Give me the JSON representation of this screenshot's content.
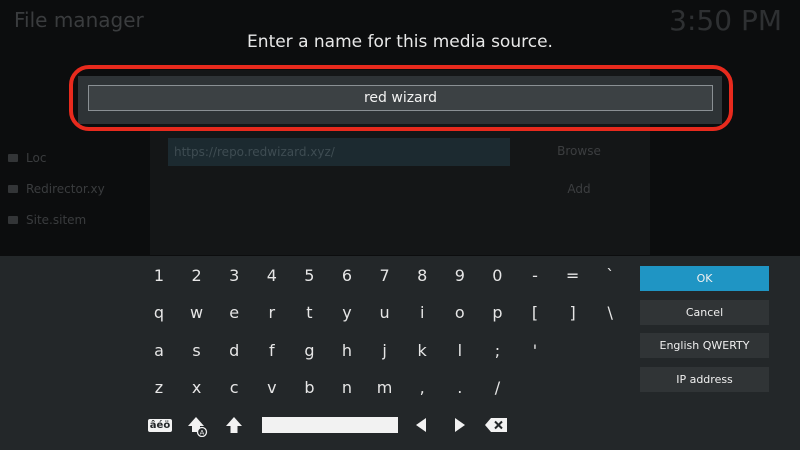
{
  "background": {
    "title": "File manager",
    "clock": "3:50 PM",
    "sidebar_items": [
      "Loc",
      "Redirector.xy",
      "Site.sitem"
    ],
    "url_value": "https://repo.redwizard.xyz/",
    "buttons": [
      "Browse",
      "Add"
    ]
  },
  "dialog": {
    "prompt": "Enter a name for this media source.",
    "name_value": "red wizard"
  },
  "keyboard": {
    "rows": [
      [
        "1",
        "2",
        "3",
        "4",
        "5",
        "6",
        "7",
        "8",
        "9",
        "0",
        "-",
        "=",
        "`"
      ],
      [
        "q",
        "w",
        "e",
        "r",
        "t",
        "y",
        "u",
        "i",
        "o",
        "p",
        "[",
        "]",
        "\\"
      ],
      [
        "a",
        "s",
        "d",
        "f",
        "g",
        "h",
        "j",
        "k",
        "l",
        ";",
        "'"
      ],
      [
        "z",
        "x",
        "c",
        "v",
        "b",
        "n",
        "m",
        ",",
        ".",
        "/"
      ]
    ],
    "special": {
      "accents_label": "âéö"
    },
    "actions": {
      "ok": "OK",
      "cancel": "Cancel",
      "layout": "English QWERTY",
      "ip": "IP address"
    }
  },
  "colors": {
    "accent": "#1f95c4",
    "highlight": "#e82a1d"
  }
}
